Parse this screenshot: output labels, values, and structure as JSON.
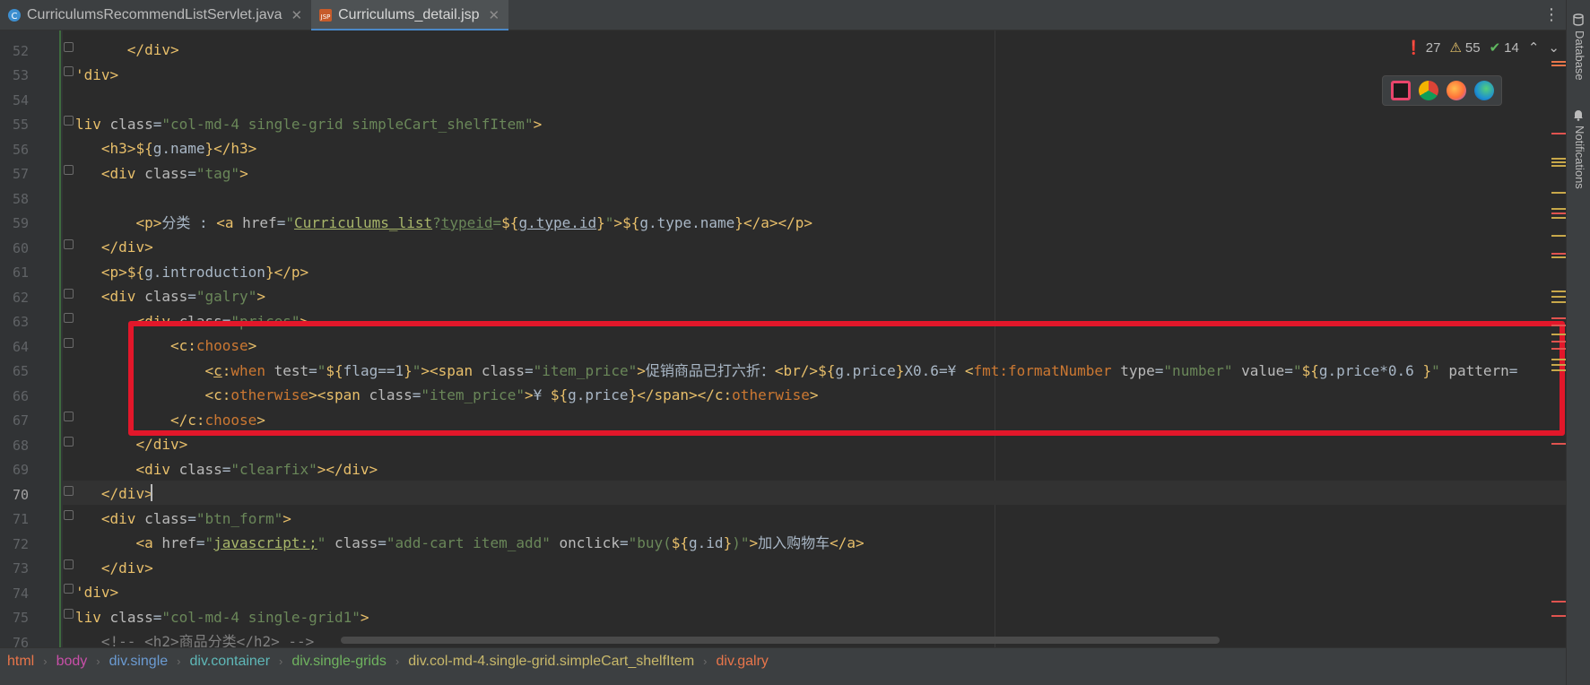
{
  "tabs": [
    {
      "label": "CurriculumsRecommendListServlet.java",
      "icon": "java-class-icon",
      "active": false
    },
    {
      "label": "Curriculums_detail.jsp",
      "icon": "jsp-file-icon",
      "active": true
    }
  ],
  "inspection": {
    "errors": "27",
    "warnings": "55",
    "typos": "14"
  },
  "right_tools": {
    "database": "Database",
    "notifications": "Notifications"
  },
  "line_numbers": [
    "52",
    "53",
    "54",
    "55",
    "56",
    "57",
    "58",
    "59",
    "60",
    "61",
    "62",
    "63",
    "64",
    "65",
    "66",
    "67",
    "68",
    "69",
    "70",
    "71",
    "72",
    "73",
    "74",
    "75",
    "76"
  ],
  "current_line": "70",
  "code": {
    "l59_text": "分类 : ",
    "l65_text": "促销商品已打六折：",
    "l65_x": "X0.6=¥ ",
    "l66_yen": "¥ ",
    "l72_text": "加入购物车",
    "l76_comment": "<!-- <h2>商品分类</h2> -->"
  },
  "breadcrumb": [
    {
      "label": "html",
      "color": "#e8754a"
    },
    {
      "label": "body",
      "color": "#c84fa8"
    },
    {
      "label": "div.single",
      "color": "#6b9bd2"
    },
    {
      "label": "div.container",
      "color": "#5fb8b8"
    },
    {
      "label": "div.single-grids",
      "color": "#6fb35f"
    },
    {
      "label": "div.col-md-4.single-grid.simpleCart_shelfItem",
      "color": "#c8b86a"
    },
    {
      "label": "div.galry",
      "color": "#e8754a"
    }
  ]
}
